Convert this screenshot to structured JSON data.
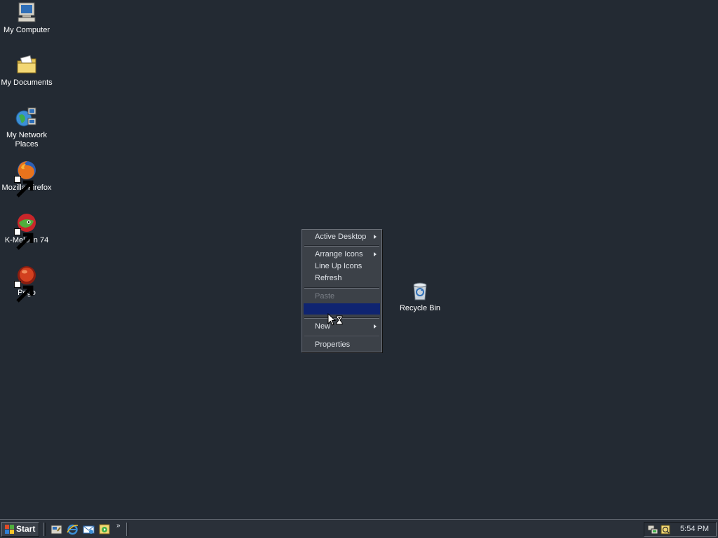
{
  "desktop": {
    "background_color": "#232a33",
    "icons": [
      {
        "label": "My Computer",
        "icon": "my-computer-icon"
      },
      {
        "label": "My Documents",
        "icon": "my-documents-icon"
      },
      {
        "label": "My Network Places",
        "icon": "my-network-places-icon"
      },
      {
        "label": "Mozilla Firefox",
        "icon": "firefox-icon",
        "shortcut": true
      },
      {
        "label": "K-Meleon 74",
        "icon": "k-meleon-icon",
        "shortcut": true
      },
      {
        "label": "Pego",
        "icon": "pego-icon",
        "shortcut": true
      },
      {
        "label": "Recycle Bin",
        "icon": "recycle-bin-icon"
      }
    ]
  },
  "context_menu": {
    "items": [
      {
        "label": "Active Desktop",
        "submenu": true,
        "enabled": true
      },
      {
        "label": "Arrange Icons",
        "submenu": true,
        "enabled": true
      },
      {
        "label": "Line Up Icons",
        "submenu": false,
        "enabled": true
      },
      {
        "label": "Refresh",
        "submenu": false,
        "enabled": true
      },
      {
        "label": "Paste",
        "submenu": false,
        "enabled": false
      },
      {
        "label": "",
        "submenu": false,
        "enabled": true,
        "highlighted": true
      },
      {
        "label": "New",
        "submenu": true,
        "enabled": true
      },
      {
        "label": "Properties",
        "submenu": false,
        "enabled": true
      }
    ],
    "highlight_color": "#0f2471"
  },
  "taskbar": {
    "start_label": "Start",
    "quick_launch": [
      "show-desktop-icon",
      "internet-explorer-icon",
      "outlook-express-icon",
      "media-icon"
    ],
    "tray_icons": [
      "network-icon",
      "volume-icon"
    ],
    "clock": "5:54 PM"
  }
}
